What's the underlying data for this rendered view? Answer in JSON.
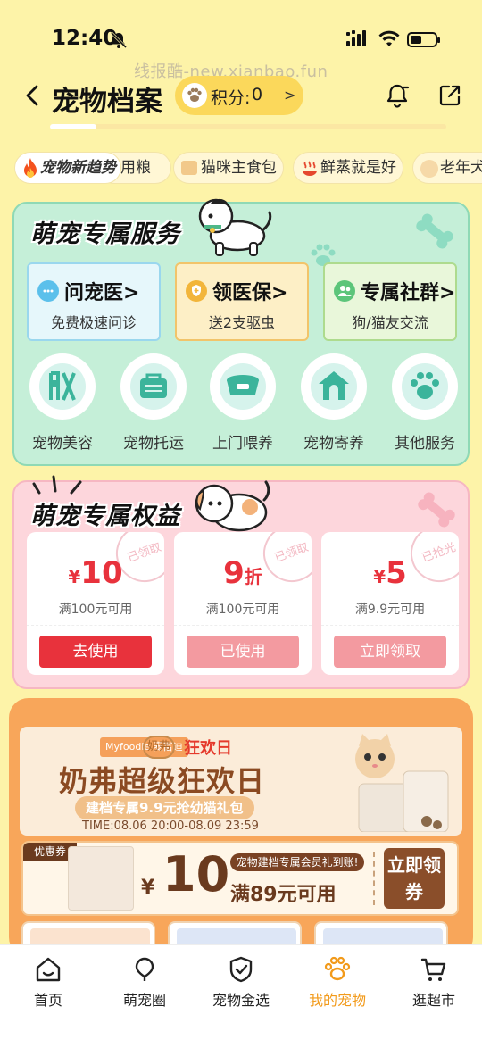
{
  "status_bar": {
    "time": "12:40"
  },
  "watermark": "线报酷-new.xianbao.fun",
  "header": {
    "title": "宠物档案",
    "points_label": "积分:",
    "points_value": "0",
    "points_arrow": ">"
  },
  "trends": {
    "main": "宠物新趋势",
    "chips": [
      "用粮",
      "猫咪主食包",
      "鲜蒸就是好",
      "老年犬"
    ]
  },
  "service": {
    "title": "萌宠专属服务",
    "boxes": [
      {
        "title": "问宠医",
        "arrow": ">",
        "sub": "免费极速问诊",
        "icon": "chat-icon"
      },
      {
        "title": "领医保",
        "arrow": ">",
        "sub": "送2支驱虫",
        "icon": "shield-icon"
      },
      {
        "title": "专属社群",
        "arrow": ">",
        "sub": "狗/猫友交流",
        "icon": "people-icon"
      }
    ],
    "items": [
      {
        "label": "宠物美容",
        "icon": "grooming-icon"
      },
      {
        "label": "宠物托运",
        "icon": "carrier-icon"
      },
      {
        "label": "上门喂养",
        "icon": "bowl-icon"
      },
      {
        "label": "宠物寄养",
        "icon": "house-icon"
      },
      {
        "label": "其他服务",
        "icon": "paw-icon"
      }
    ]
  },
  "benefits": {
    "title": "萌宠专属权益",
    "coupons": [
      {
        "stamp": "已领取",
        "prefix": "¥",
        "amount": "10",
        "suffix": "",
        "condition": "满100元可用",
        "button": "去使用",
        "button_color": "#E8323C"
      },
      {
        "stamp": "已领取",
        "prefix": "",
        "amount": "9",
        "suffix": "折",
        "condition": "满100元可用",
        "button": "已使用",
        "button_color": "#F39AA0"
      },
      {
        "stamp": "已抢光",
        "prefix": "¥",
        "amount": "5",
        "suffix": "",
        "condition": "满9.9元可用",
        "button": "立即领取",
        "button_color": "#F39AA0"
      }
    ]
  },
  "promo": {
    "brand": "Myfoodie 麦富迪",
    "brand2": "奶弗",
    "tag": "狂欢日",
    "headline": "奶弗超级狂欢日",
    "sub": "建档专属9.9元抢幼猫礼包",
    "time": "TIME:08.06 20:00-08.09 23:59",
    "coupon_tag": "优惠券",
    "coupon_currency": "¥",
    "coupon_amount": "10",
    "coupon_note": "宠物建档专属会员礼到账!",
    "coupon_min": "满89元可用",
    "coupon_claim": "立即领券"
  },
  "bottom_nav": [
    {
      "label": "首页",
      "icon": "home-icon",
      "active": false
    },
    {
      "label": "萌宠圈",
      "icon": "balloon-icon",
      "active": false
    },
    {
      "label": "宠物金选",
      "icon": "badge-check-icon",
      "active": false
    },
    {
      "label": "我的宠物",
      "icon": "paw-icon",
      "active": true
    },
    {
      "label": "逛超市",
      "icon": "cart-icon",
      "active": false
    }
  ],
  "colors": {
    "background": "#FDF3A8",
    "accent": "#F29A1A",
    "service_bg": "#C5EFD8",
    "benefit_bg": "#FDD6DC",
    "coupon_red": "#E8323C"
  }
}
